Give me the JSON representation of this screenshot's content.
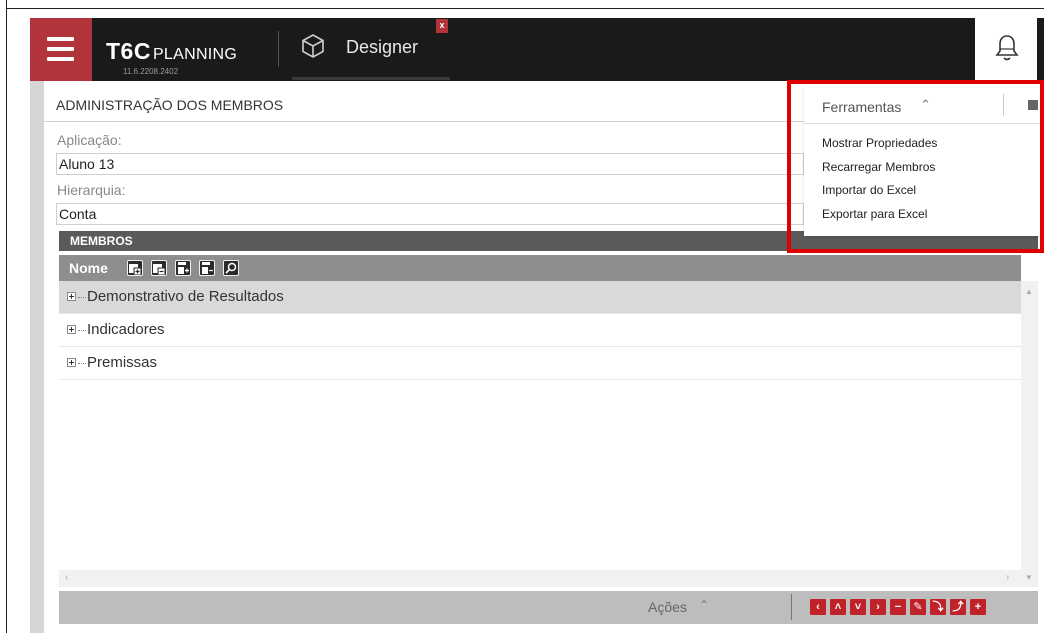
{
  "app": {
    "brand": "T6C",
    "product": "PLANNING",
    "version": "11.6.2208.2402",
    "module": "Designer",
    "close_label": "x",
    "colors": {
      "accent": "#b0343a",
      "header": "#1a1a1a",
      "highlight": "#e00000"
    }
  },
  "icons": {
    "menu": "hamburger-icon",
    "module": "cube-icon",
    "notifications": "bell-icon"
  },
  "panel": {
    "title": "ADMINISTRAÇÃO DOS MEMBROS",
    "application_label": "Aplicação:",
    "application_value": "Aluno 13",
    "hierarchy_label": "Hierarquia:",
    "hierarchy_value": "Conta"
  },
  "grid": {
    "section_title": "MEMBROS",
    "column_header": "Nome",
    "toolbar_icons": [
      "expand-all-icon",
      "collapse-all-icon",
      "expand-level-icon",
      "collapse-level-icon",
      "search-icon"
    ],
    "rows": [
      {
        "label": "Demonstrativo de Resultados",
        "selected": true
      },
      {
        "label": "Indicadores",
        "selected": false
      },
      {
        "label": "Premissas",
        "selected": false
      }
    ]
  },
  "actions": {
    "label": "Ações",
    "buttons": [
      {
        "glyph": "‹",
        "icon": "move-left-icon"
      },
      {
        "glyph": "˄",
        "icon": "move-up-icon"
      },
      {
        "glyph": "˅",
        "icon": "move-down-icon"
      },
      {
        "glyph": "›",
        "icon": "move-right-icon"
      },
      {
        "glyph": "−",
        "icon": "remove-icon"
      },
      {
        "glyph": "✎",
        "icon": "edit-icon"
      },
      {
        "glyph": "⤵",
        "icon": "insert-below-icon"
      },
      {
        "glyph": "⤴",
        "icon": "insert-above-icon"
      },
      {
        "glyph": "+",
        "icon": "add-icon"
      }
    ]
  },
  "tools_menu": {
    "title": "Ferramentas",
    "items": [
      "Mostrar Propriedades",
      "Recarregar Membros",
      "Importar do Excel",
      "Exportar para Excel"
    ]
  }
}
